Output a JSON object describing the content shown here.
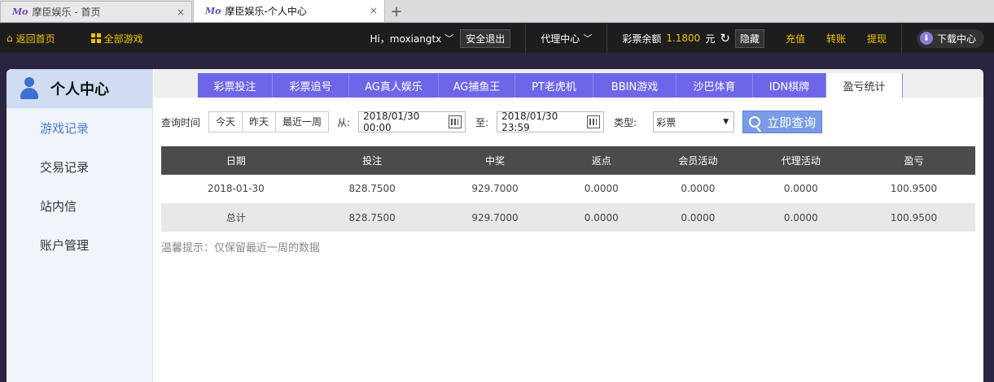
{
  "browser": {
    "tabs": [
      {
        "label": "摩臣娱乐 - 首页",
        "active": false
      },
      {
        "label": "摩臣娱乐-个人中心",
        "active": true
      }
    ],
    "favicon_text": "Mo",
    "close_glyph": "×",
    "new_tab_glyph": "+"
  },
  "topbar": {
    "home": "返回首页",
    "games": "全部游戏",
    "user": "Hi，moxiangtx",
    "logout": "安全退出",
    "agent": "代理中心",
    "balance_label": "彩票余额",
    "balance": "1.1800",
    "currency": "元",
    "hide": "隐藏",
    "recharge": "充值",
    "transfer": "转账",
    "withdraw": "提现",
    "download": "下载中心"
  },
  "sidebar": {
    "title": "个人中心",
    "items": [
      {
        "label": "游戏记录",
        "active": true
      },
      {
        "label": "交易记录",
        "active": false
      },
      {
        "label": "站内信",
        "active": false
      },
      {
        "label": "账户管理",
        "active": false
      }
    ]
  },
  "game_tabs": [
    {
      "label": "彩票投注",
      "active": false
    },
    {
      "label": "彩票追号",
      "active": false
    },
    {
      "label": "AG真人娱乐",
      "active": false
    },
    {
      "label": "AG捕鱼王",
      "active": false
    },
    {
      "label": "PT老虎机",
      "active": false
    },
    {
      "label": "BBIN游戏",
      "active": false
    },
    {
      "label": "沙巴体育",
      "active": false
    },
    {
      "label": "IDN棋牌",
      "active": false
    },
    {
      "label": "盈亏统计",
      "active": true
    }
  ],
  "query": {
    "time_label": "查询时间",
    "quick": [
      "今天",
      "昨天",
      "最近一周"
    ],
    "from_label": "从:",
    "from_value": "2018/01/30 00:00",
    "to_label": "至:",
    "to_value": "2018/01/30 23:59",
    "type_label": "类型:",
    "type_value": "彩票",
    "button": "立即查询"
  },
  "table": {
    "headers": [
      "日期",
      "投注",
      "中奖",
      "返点",
      "会员活动",
      "代理活动",
      "盈亏"
    ],
    "rows": [
      [
        "2018-01-30",
        "828.7500",
        "929.7000",
        "0.0000",
        "0.0000",
        "0.0000",
        "100.9500"
      ],
      [
        "总计",
        "828.7500",
        "929.7000",
        "0.0000",
        "0.0000",
        "0.0000",
        "100.9500"
      ]
    ]
  },
  "tip": "温馨提示：仅保留最近一周的数据",
  "colors": {
    "accent": "#6e66e8",
    "gold": "#f2c200",
    "table_header": "#4b4b4b",
    "sidebar_active": "#4d7ad6"
  }
}
